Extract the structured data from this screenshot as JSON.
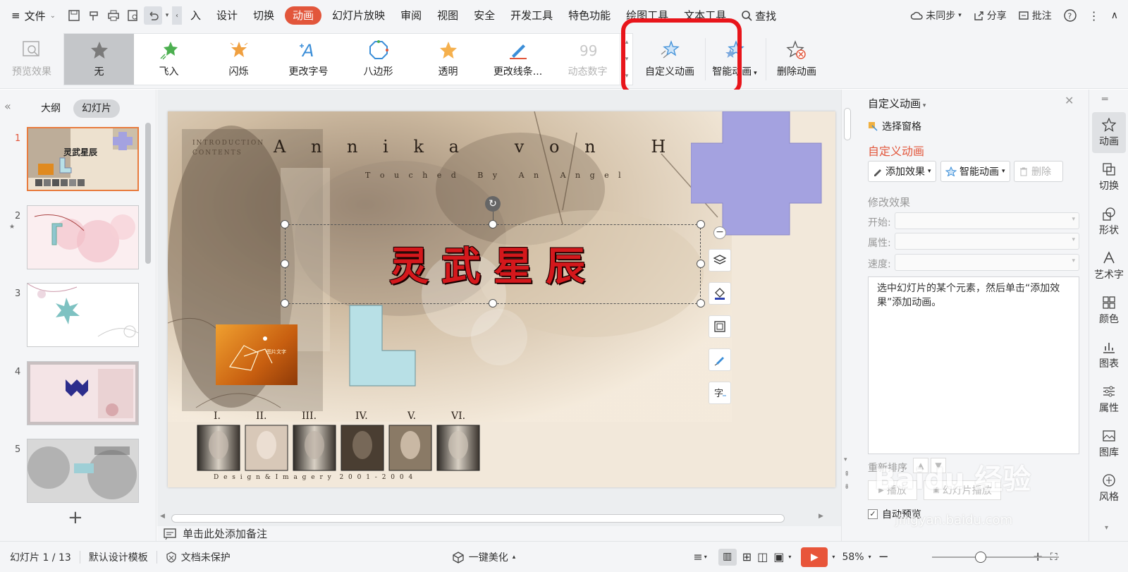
{
  "menubar": {
    "file_label": "文件",
    "tabs": [
      "入",
      "设计",
      "切换",
      "动画",
      "幻灯片放映",
      "审阅",
      "视图",
      "安全",
      "开发工具",
      "特色功能",
      "绘图工具",
      "文本工具"
    ],
    "search_label": "查找",
    "sync_label": "未同步",
    "share_label": "分享",
    "comment_label": "批注",
    "active_tab": "动画"
  },
  "ribbon": {
    "preview_label": "预览效果",
    "gallery": [
      "无",
      "飞入",
      "闪烁",
      "更改字号",
      "八边形",
      "透明",
      "更改线条...",
      "动态数字"
    ],
    "custom_anim_label": "自定义动画",
    "smart_anim_label": "智能动画",
    "delete_anim_label": "删除动画"
  },
  "left_panel": {
    "tab_outline": "大纲",
    "tab_slides": "幻灯片",
    "slide_numbers": [
      "1",
      "2",
      "3",
      "4",
      "5"
    ],
    "add_label": "+"
  },
  "slide": {
    "intro_text": "INTRODUCTION CONTENTS",
    "name_text": "A n n i k a   v o n   H o l",
    "subtitle_text": "T o u c h e d   B y   A n   A n g e l",
    "title_text": "灵武星辰",
    "thumb_caption": "图片文字",
    "numerals": [
      "I.",
      "II.",
      "III.",
      "IV.",
      "V.",
      "VI."
    ],
    "footer_text": "D e s i g n & I m a g e r y  2 0 0 1 - 2 0 0 4"
  },
  "notes_placeholder": "单击此处添加备注",
  "right_pane": {
    "title": "自定义动画",
    "select_pane_label": "选择窗格",
    "section_label": "自定义动画",
    "add_effect_label": "添加效果",
    "smart_anim_label": "智能动画",
    "delete_label": "删除",
    "modify_label": "修改效果",
    "start_label": "开始:",
    "property_label": "属性:",
    "speed_label": "速度:",
    "help_text": "选中幻灯片的某个元素，然后单击“添加效果”添加动画。",
    "reorder_label": "重新排序",
    "play_label": "播放",
    "slide_play_label": "幻灯片播放",
    "auto_preview_label": "自动预览"
  },
  "far_right": [
    "动画",
    "切换",
    "形状",
    "艺术字",
    "颜色",
    "图表",
    "属性",
    "图库",
    "风格"
  ],
  "status": {
    "slide_counter": "幻灯片 1 / 13",
    "template": "默认设计模板",
    "protect": "文档未保护",
    "beautify": "一键美化",
    "zoom": "58%"
  },
  "watermark": {
    "brand": "Baidu 经验",
    "url": "jingyan.baidu.com"
  },
  "colors": {
    "accent": "#e2563b",
    "highlight_red": "#e8151b",
    "plus_shape": "#a4a2e0",
    "l_shape": "#b8e0e6",
    "title_red": "#d4181c"
  }
}
